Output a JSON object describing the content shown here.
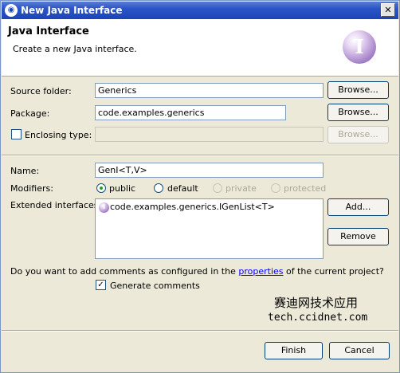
{
  "window": {
    "title": "New Java Interface",
    "close_glyph": "✕"
  },
  "banner": {
    "title": "Java Interface",
    "description": "Create a new Java interface.",
    "icon_letter": "I",
    "icon": "interface-wizard-icon"
  },
  "form": {
    "source_folder": {
      "label": "Source folder:",
      "value": "Generics",
      "browse": "Browse..."
    },
    "package": {
      "label": "Package:",
      "value": "code.examples.generics",
      "browse": "Browse..."
    },
    "enclosing_type": {
      "label": "Enclosing type:",
      "value": "",
      "browse": "Browse...",
      "checked": false
    },
    "name": {
      "label": "Name:",
      "value": "GenI<T,V>"
    },
    "modifiers": {
      "label": "Modifiers:",
      "options": [
        {
          "label": "public",
          "selected": true,
          "enabled": true
        },
        {
          "label": "default",
          "selected": false,
          "enabled": true
        },
        {
          "label": "private",
          "selected": false,
          "enabled": false
        },
        {
          "label": "protected",
          "selected": false,
          "enabled": false
        }
      ]
    },
    "extended_interfaces": {
      "label": "Extended interfaces:",
      "items": [
        "code.examples.generics.IGenList<T>"
      ],
      "add": "Add...",
      "remove": "Remove"
    },
    "comments": {
      "question_before": "Do you want to add comments as configured in the ",
      "link": "properties",
      "question_after": " of the current project?",
      "generate_label": "Generate comments",
      "generate_checked": true,
      "check_glyph": "✓"
    }
  },
  "watermark": {
    "chinese": "赛迪网技术应用",
    "url": "tech.ccidnet.com"
  },
  "footer": {
    "finish": "Finish",
    "cancel": "Cancel"
  }
}
